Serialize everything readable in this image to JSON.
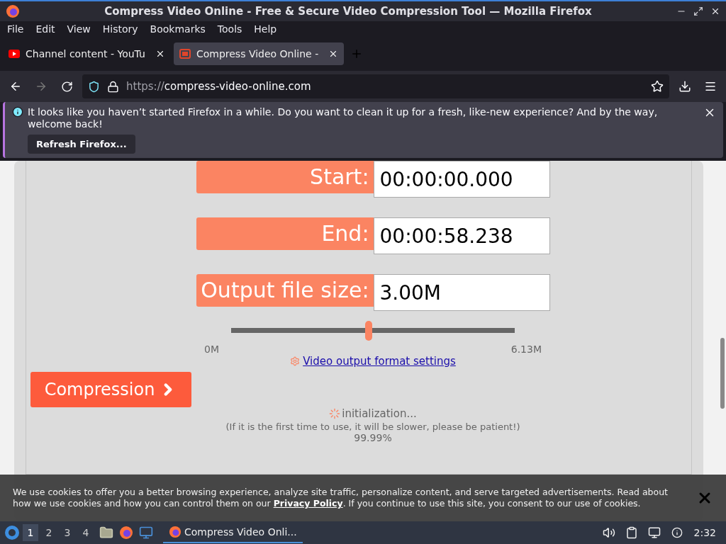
{
  "window": {
    "title": "Compress Video Online - Free & Secure Video Compression Tool — Mozilla Firefox"
  },
  "menu": [
    "File",
    "Edit",
    "View",
    "History",
    "Bookmarks",
    "Tools",
    "Help"
  ],
  "tabs": [
    {
      "label": "Channel content - YouTu",
      "selected": false
    },
    {
      "label": "Compress Video Online -",
      "selected": true
    }
  ],
  "address": {
    "scheme": "https://",
    "host": "compress-video-online.com"
  },
  "notification": {
    "message": "It looks like you haven’t started Firefox in a while. Do you want to clean it up for a fresh, like-new experience? And by the way, welcome back!",
    "button": "Refresh Firefox..."
  },
  "form": {
    "fields": [
      {
        "label": "Start:",
        "value": "00:00:00.000"
      },
      {
        "label": "End:",
        "value": "00:00:58.238"
      },
      {
        "label": "Output file size:",
        "value": "3.00M"
      }
    ],
    "slider": {
      "level": 0.485,
      "min_label": "0M",
      "max_label": "6.13M"
    },
    "settings_link": "Video output format settings",
    "compress_button": "Compression",
    "status": "initialization...",
    "note": "(If it is the first time to use, it will be slower, please be patient!)",
    "progress": "99.99%"
  },
  "cookie_banner": {
    "before": "We use cookies to offer you a better browsing experience, analyze site traffic, personalize content, and serve targeted advertisements. Read about how we use cookies and how you can control them on our ",
    "link": "Privacy Policy",
    "after": ". If you continue to use this site, you consent to our use of cookies."
  },
  "taskbar": {
    "workspaces": [
      {
        "label": "1",
        "selected": true
      },
      {
        "label": "2",
        "selected": false
      },
      {
        "label": "3",
        "selected": false
      },
      {
        "label": "4",
        "selected": false
      }
    ],
    "task": "Compress Video Onli...",
    "clock": "2:32"
  }
}
